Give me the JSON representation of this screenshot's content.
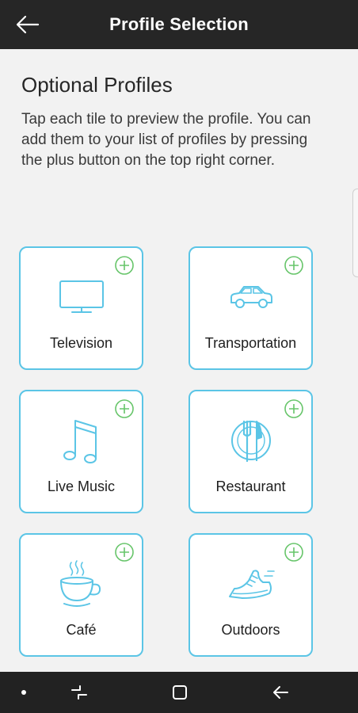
{
  "app_bar": {
    "title": "Profile Selection",
    "back_icon": "arrow-left-icon"
  },
  "heading": "Optional Profiles",
  "description": "Tap each tile to preview the profile. You can add them to your list of profiles by pressing the plus button on the top right corner.",
  "tiles": [
    {
      "label": "Television",
      "icon": "television-icon"
    },
    {
      "label": "Transportation",
      "icon": "car-icon"
    },
    {
      "label": "Live Music",
      "icon": "music-note-icon"
    },
    {
      "label": "Restaurant",
      "icon": "plate-fork-knife-icon"
    },
    {
      "label": "Café",
      "icon": "coffee-cup-icon"
    },
    {
      "label": "Outdoors",
      "icon": "running-shoe-icon"
    }
  ],
  "colors": {
    "accent": "#5bc5e6",
    "plus": "#67c56a",
    "app_bar": "#262626",
    "background": "#f2f2f2"
  },
  "nav_bar": {
    "items": [
      "dot-icon",
      "recents-icon",
      "home-icon",
      "back-icon"
    ]
  }
}
